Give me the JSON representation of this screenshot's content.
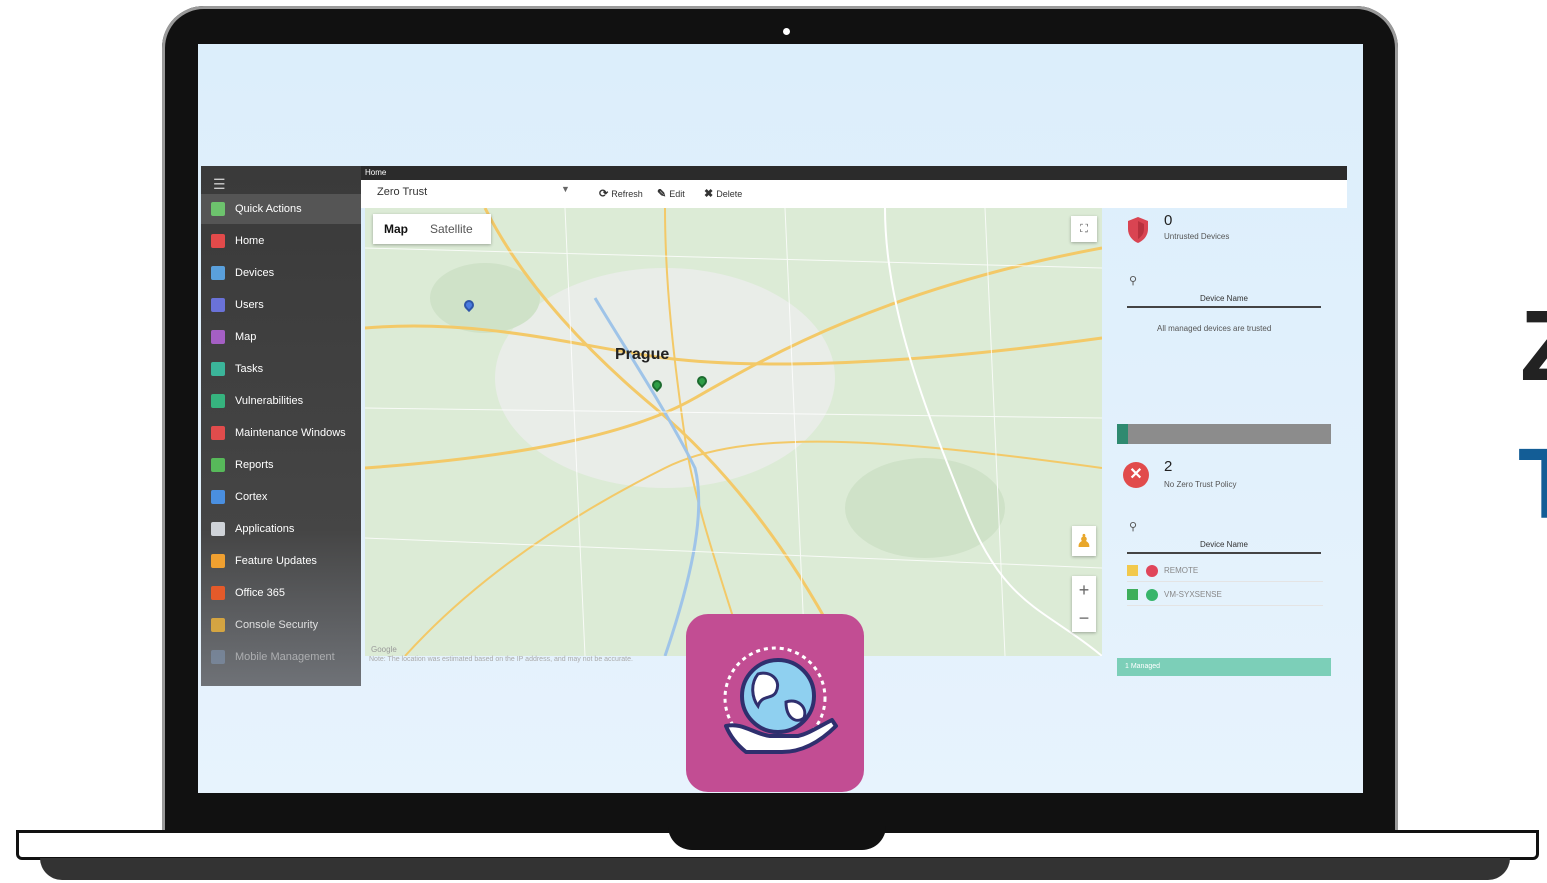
{
  "side_text": {
    "line1": "Z",
    "line2": "T"
  },
  "topbar": {
    "title": "Home"
  },
  "sidebar": {
    "items": [
      {
        "label": "Quick Actions",
        "icon": "plus-icon",
        "color": "#6dc36d"
      },
      {
        "label": "Home",
        "icon": "home-icon",
        "color": "#e24a4a"
      },
      {
        "label": "Devices",
        "icon": "monitor-icon",
        "color": "#5aa0dc"
      },
      {
        "label": "Users",
        "icon": "users-icon",
        "color": "#6a72d8"
      },
      {
        "label": "Map",
        "icon": "map-icon",
        "color": "#a45fc4"
      },
      {
        "label": "Tasks",
        "icon": "tasks-icon",
        "color": "#3bb59a"
      },
      {
        "label": "Vulnerabilities",
        "icon": "shield-icon",
        "color": "#36b37e"
      },
      {
        "label": "Maintenance Windows",
        "icon": "tools-icon",
        "color": "#e14c4c"
      },
      {
        "label": "Reports",
        "icon": "chart-icon",
        "color": "#57b95a"
      },
      {
        "label": "Cortex",
        "icon": "cortex-icon",
        "color": "#4a8fe0"
      },
      {
        "label": "Applications",
        "icon": "apps-icon",
        "color": "#cfd3d8"
      },
      {
        "label": "Feature Updates",
        "icon": "windows-icon",
        "color": "#f0a030"
      },
      {
        "label": "Office 365",
        "icon": "office-icon",
        "color": "#e45a2a"
      },
      {
        "label": "Console Security",
        "icon": "lock-icon",
        "color": "#f2b63a"
      },
      {
        "label": "Mobile Management",
        "icon": "mobile-icon",
        "color": "#8aa4c8"
      }
    ]
  },
  "toolbar": {
    "dropdown_value": "Zero Trust",
    "refresh_label": "Refresh",
    "edit_label": "Edit",
    "delete_label": "Delete"
  },
  "map": {
    "tab_map": "Map",
    "tab_satellite": "Satellite",
    "city_label": "Prague",
    "credit": "Google",
    "note": "Note: The location was estimated based on the IP address, and may not be accurate."
  },
  "panel": {
    "untrusted": {
      "count": "0",
      "label": "Untrusted Devices",
      "column": "Device Name",
      "message": "All managed devices are trusted"
    },
    "no_policy": {
      "count": "2",
      "label": "No Zero Trust Policy",
      "column": "Device Name"
    },
    "devices": [
      {
        "name": "REMOTE",
        "os_color": "#f2c94c",
        "status_color": "#e0455a"
      },
      {
        "name": "VM-SYXSENSE",
        "os_color": "#3fae5b",
        "status_color": "#37b56a"
      }
    ],
    "bar_fraction": 0.05,
    "footer_label": "1 Managed"
  },
  "colors": {
    "accent": "#c24d93",
    "brand_blue": "#135d96"
  }
}
